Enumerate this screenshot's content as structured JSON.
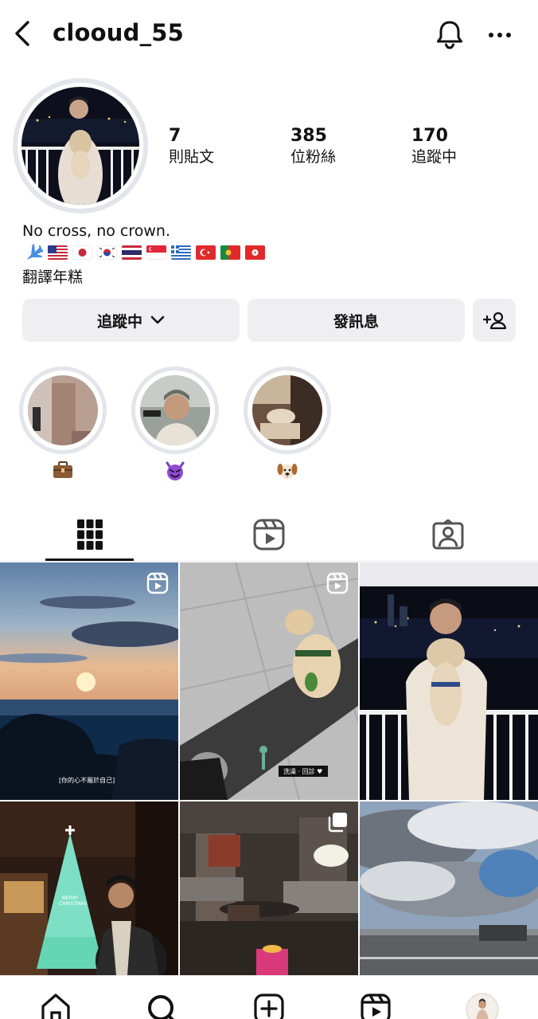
{
  "header": {
    "username": "clooud_55"
  },
  "stats": {
    "posts_count": "7",
    "posts_label": "則貼文",
    "followers_count": "385",
    "followers_label": "位粉絲",
    "following_count": "170",
    "following_label": "追蹤中"
  },
  "bio": {
    "text": "No cross, no crown.",
    "flags": [
      "✈️",
      "🇺🇸",
      "🇯🇵",
      "🇰🇷",
      "🇹🇭",
      "🇸🇬",
      "🇬🇷",
      "🇹🇷",
      "🇵🇹",
      "🇭🇰"
    ],
    "subtext": "翻譯年糕"
  },
  "actions": {
    "following_label": "追蹤中",
    "message_label": "發訊息"
  },
  "highlights": [
    {
      "emoji": "💼"
    },
    {
      "emoji": "😈"
    },
    {
      "emoji": "🐶"
    }
  ],
  "tabs": [
    "grid-icon",
    "reels-icon",
    "tagged-icon"
  ],
  "posts": [
    {
      "type": "reel",
      "scene": "sunset-sea",
      "caption": "[你的心不屬於自己]"
    },
    {
      "type": "reel",
      "scene": "dog-on-mat",
      "caption": "洗澡 · 回診 ♥"
    },
    {
      "type": "photo",
      "scene": "man-holding-dog-night"
    },
    {
      "type": "photo",
      "scene": "christmas-tree",
      "caption": "MERRY CHRISTMAS"
    },
    {
      "type": "carousel",
      "scene": "hotel-lobby"
    },
    {
      "type": "photo",
      "scene": "cloudy-sky-airport"
    }
  ],
  "bottom_nav": [
    "home-icon",
    "search-icon",
    "create-icon",
    "reels-icon",
    "profile-avatar"
  ],
  "colors": {
    "text": "#111111",
    "button_bg": "#efeff2",
    "ring": "#e4e5ea"
  }
}
